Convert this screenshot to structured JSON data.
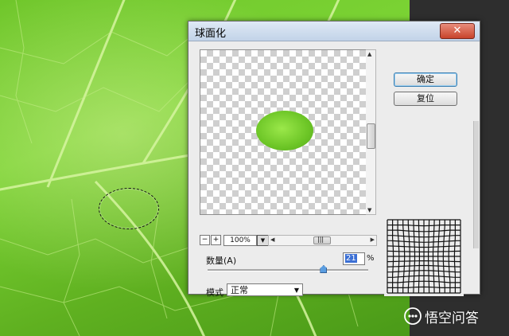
{
  "dialog": {
    "title": "球面化",
    "close_glyph": "✕",
    "ok_label": "确定",
    "reset_label": "复位"
  },
  "preview": {
    "zoom_out_glyph": "−",
    "zoom_in_glyph": "+",
    "zoom_value": "100%",
    "dropdown_glyph": "▼",
    "scroll_up_glyph": "▲",
    "scroll_down_glyph": "▼",
    "scroll_left_glyph": "◀",
    "scroll_right_glyph": "▶",
    "scroll_grip": "|||"
  },
  "amount": {
    "label": "数量(A)",
    "value": "21",
    "unit": "%",
    "slider_fraction": 0.72
  },
  "mode": {
    "label": "模式",
    "selected": "正常",
    "caret_glyph": "▼"
  },
  "watermark": {
    "text": "悟空问答"
  },
  "colors": {
    "leaf_green": "#6fc62a",
    "dialog_bg": "#ececec",
    "close_red": "#c8432b",
    "selection_blue": "#3b6fd4"
  },
  "icons": {
    "close": "close-icon",
    "zoom_out": "zoom-out-icon",
    "zoom_in": "zoom-in-icon",
    "dropdown": "chevron-down-icon",
    "watermark": "speech-bubble-icon"
  }
}
